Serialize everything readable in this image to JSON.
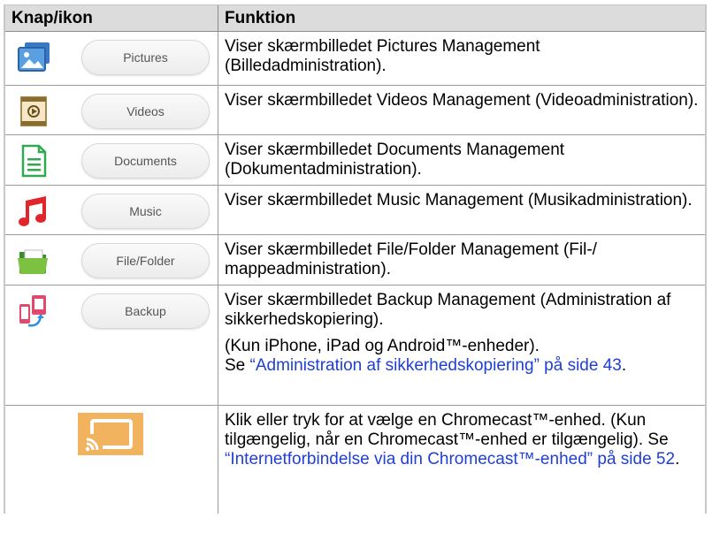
{
  "table": {
    "headers": {
      "button_icon": "Knap/ikon",
      "function": "Funktion"
    },
    "rows": [
      {
        "icon": "pictures-icon",
        "button": "Pictures",
        "function": "Viser skærmbilledet Pictures Management (Billedadministration)."
      },
      {
        "icon": "videos-icon",
        "button": "Videos",
        "function": "Viser skærmbilledet Videos Management (Videoadministration)."
      },
      {
        "icon": "documents-icon",
        "button": "Documents",
        "function": "Viser skærmbilledet Documents Management (Dokumentadministration)."
      },
      {
        "icon": "music-icon",
        "button": "Music",
        "function": "Viser skærmbilledet Music Management (Musikadministration)."
      },
      {
        "icon": "file-folder-icon",
        "button": "File/Folder",
        "function": "Viser skærmbilledet File/Folder Management (Fil-/ mappeadministration)."
      },
      {
        "icon": "backup-icon",
        "button": "Backup",
        "function": "Viser skærmbilledet Backup Management (Administration af sikkerhedskopiering).",
        "note": "(Kun iPhone, iPad og Android™-enheder).",
        "ref_prefix": "Se ",
        "ref_link": "“Administration af sikkerhedskopiering” på side 43",
        "ref_suffix": "."
      },
      {
        "icon": "chromecast-icon",
        "function": "Klik eller tryk for at vælge en Chromecast™-enhed. (Kun tilgængelig, når en Chromecast™-enhed er tilgængelig). Se ",
        "ref_link": "“Internetforbindelse via din Chromecast™-enhed” på side 52",
        "ref_suffix": "."
      }
    ]
  },
  "colors": {
    "header_bg": "#dcdcdc",
    "link": "#1f3fd2",
    "cast_bg": "#f2b35f"
  }
}
